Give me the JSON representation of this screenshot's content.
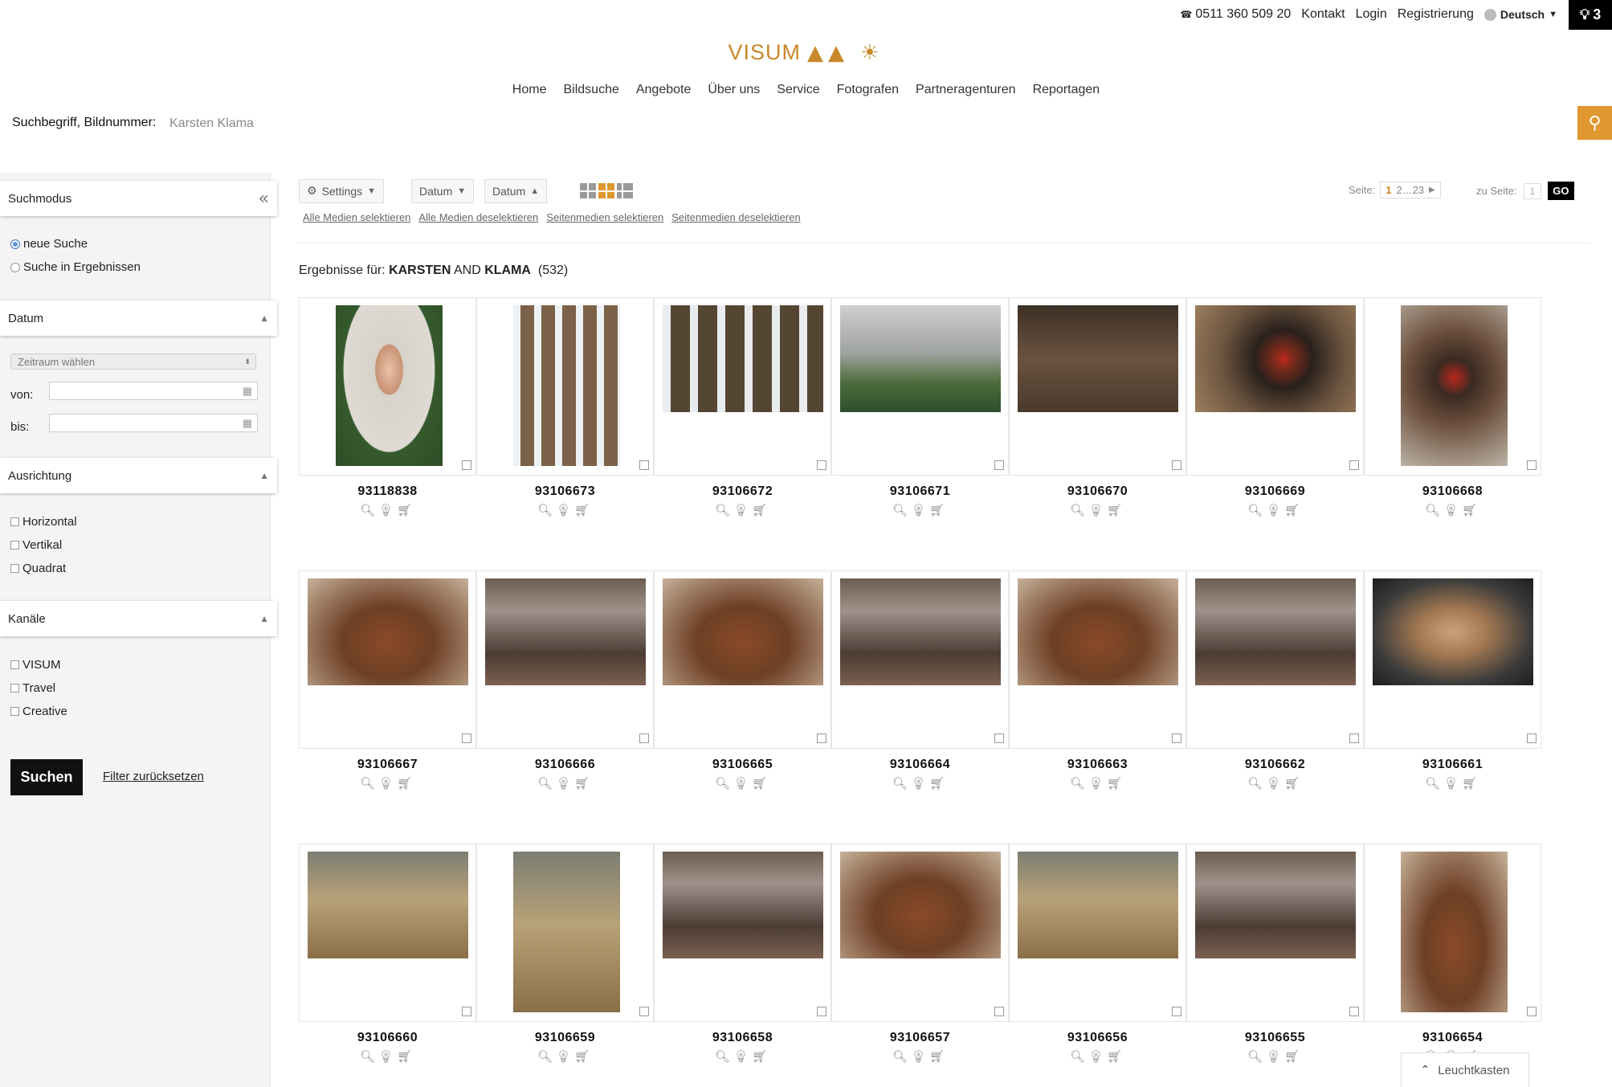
{
  "topbar": {
    "phone": "0511 360 509 20",
    "kontakt": "Kontakt",
    "login": "Login",
    "registrierung": "Registrierung",
    "language": "Deutsch",
    "lightbox_count": "3"
  },
  "logo": {
    "text": "VISUM"
  },
  "nav": [
    "Home",
    "Bildsuche",
    "Angebote",
    "Über uns",
    "Service",
    "Fotografen",
    "Partneragenturen",
    "Reportagen"
  ],
  "search": {
    "label": "Suchbegriff, Bildnummer:",
    "value": "Karsten Klama"
  },
  "sidebar": {
    "suchmodus": {
      "title": "Suchmodus",
      "options": [
        "neue Suche",
        "Suche in Ergebnissen"
      ]
    },
    "datum": {
      "title": "Datum",
      "zeitraum": "Zeitraum wählen",
      "von": "von:",
      "bis": "bis:"
    },
    "ausrichtung": {
      "title": "Ausrichtung",
      "options": [
        "Horizontal",
        "Vertikal",
        "Quadrat"
      ]
    },
    "kanaele": {
      "title": "Kanäle",
      "options": [
        "VISUM",
        "Travel",
        "Creative"
      ]
    },
    "suchen": "Suchen",
    "reset": "Filter zurücksetzen"
  },
  "toolbar": {
    "settings": "Settings",
    "sort1": "Datum",
    "sort2": "Datum",
    "links": [
      "Alle Medien selektieren",
      "Alle Medien deselektieren",
      "Seitenmedien selektieren",
      "Seitenmedien deselektieren"
    ],
    "pager": {
      "label": "Seite:",
      "current": "1",
      "next": "2",
      "ellipsis": "...",
      "last": "23"
    },
    "goto": {
      "label": "zu Seite:",
      "value": "1",
      "go": "GO"
    }
  },
  "results": {
    "prefix": "Ergebnisse für:",
    "term1": "KARSTEN",
    "op": "AND",
    "term2": "KLAMA",
    "count": "(532)"
  },
  "images": [
    {
      "id": "93118838",
      "orient": "v",
      "theme": "portrait"
    },
    {
      "id": "93106673",
      "orient": "v",
      "theme": "cage"
    },
    {
      "id": "93106672",
      "orient": "h",
      "theme": "cage2"
    },
    {
      "id": "93106671",
      "orient": "h",
      "theme": "farmer"
    },
    {
      "id": "93106670",
      "orient": "h",
      "theme": "barn"
    },
    {
      "id": "93106669",
      "orient": "h",
      "theme": "hen"
    },
    {
      "id": "93106668",
      "orient": "v",
      "theme": "hen2"
    },
    {
      "id": "93106667",
      "orient": "h",
      "theme": "flock"
    },
    {
      "id": "93106666",
      "orient": "h",
      "theme": "flock2"
    },
    {
      "id": "93106665",
      "orient": "h",
      "theme": "flock"
    },
    {
      "id": "93106664",
      "orient": "h",
      "theme": "flock2"
    },
    {
      "id": "93106663",
      "orient": "h",
      "theme": "flock"
    },
    {
      "id": "93106662",
      "orient": "h",
      "theme": "flock2"
    },
    {
      "id": "93106661",
      "orient": "h",
      "theme": "eggs"
    },
    {
      "id": "93106660",
      "orient": "h",
      "theme": "hay"
    },
    {
      "id": "93106659",
      "orient": "v",
      "theme": "hay"
    },
    {
      "id": "93106658",
      "orient": "h",
      "theme": "flock2"
    },
    {
      "id": "93106657",
      "orient": "h",
      "theme": "flock"
    },
    {
      "id": "93106656",
      "orient": "h",
      "theme": "hay"
    },
    {
      "id": "93106655",
      "orient": "h",
      "theme": "flock2"
    },
    {
      "id": "93106654",
      "orient": "v",
      "theme": "flock"
    }
  ],
  "leuchtkasten": "Leuchtkasten",
  "colors": {
    "accent": "#e0972f",
    "logo": "#c8882a"
  }
}
